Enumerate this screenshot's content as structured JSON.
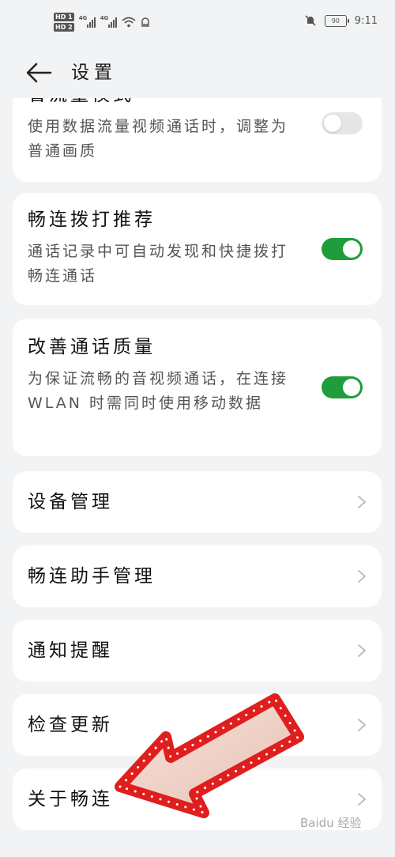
{
  "status_bar": {
    "hd1": "HD 1",
    "hd2": "HD 2",
    "net1": "4G",
    "net2": "4G",
    "battery": "90",
    "time": "9:11"
  },
  "header": {
    "title": "设置"
  },
  "settings": {
    "video_quality": {
      "title": "省流量模式",
      "desc": "使用数据流量视频通话时，调整为普通画质",
      "enabled": false
    },
    "dial_recommend": {
      "title": "畅连拨打推荐",
      "desc": "通话记录中可自动发现和快捷拨打畅连通话",
      "enabled": true
    },
    "call_quality": {
      "title": "改善通话质量",
      "desc": "为保证流畅的音视频通话，在连接 WLAN 时需同时使用移动数据",
      "enabled": true
    }
  },
  "nav_items": [
    {
      "label": "设备管理"
    },
    {
      "label": "畅连助手管理"
    },
    {
      "label": "通知提醒"
    },
    {
      "label": "检查更新"
    },
    {
      "label": "关于畅连"
    }
  ],
  "watermark": "Baidu 经验",
  "colors": {
    "accent": "#1f9d3a",
    "background": "#f1f3f5",
    "card": "#ffffff",
    "arrow": "#e53935"
  }
}
